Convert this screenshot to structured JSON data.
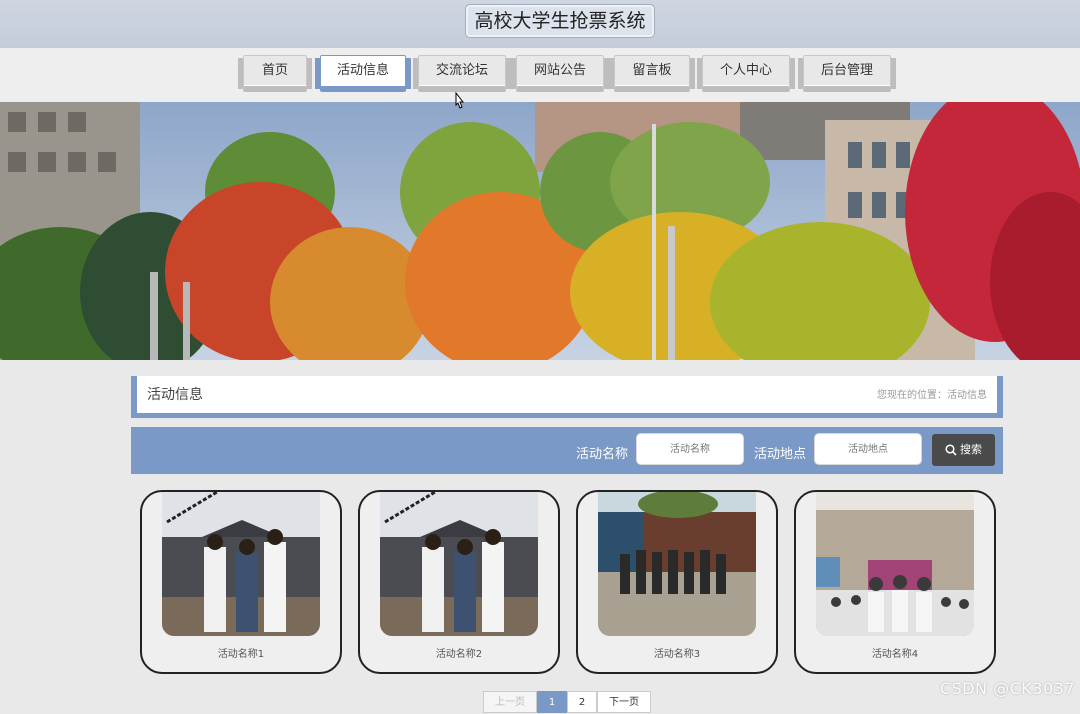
{
  "site": {
    "title": "高校大学生抢票系统"
  },
  "nav": {
    "items": [
      {
        "label": "首页",
        "active": false
      },
      {
        "label": "活动信息",
        "active": true
      },
      {
        "label": "交流论坛",
        "active": false
      },
      {
        "label": "网站公告",
        "active": false
      },
      {
        "label": "留言板",
        "active": false
      },
      {
        "label": "个人中心",
        "active": false
      },
      {
        "label": "后台管理",
        "active": false
      }
    ]
  },
  "panel": {
    "title": "活动信息",
    "breadcrumb": "您现在的位置：活动信息"
  },
  "search": {
    "name_label": "活动名称",
    "name_placeholder": "活动名称",
    "location_label": "活动地点",
    "location_placeholder": "活动地点",
    "button_label": "搜索"
  },
  "activities": [
    {
      "name": "活动名称1"
    },
    {
      "name": "活动名称2"
    },
    {
      "name": "活动名称3"
    },
    {
      "name": "活动名称4"
    }
  ],
  "pagination": {
    "prev": "上一页",
    "pages": [
      "1",
      "2"
    ],
    "current": "1",
    "next": "下一页"
  },
  "watermark": "CSDN @CK3037",
  "colors": {
    "accent": "#7b99c6",
    "search_button": "#4a4a4a",
    "header": "#c9d1de"
  }
}
